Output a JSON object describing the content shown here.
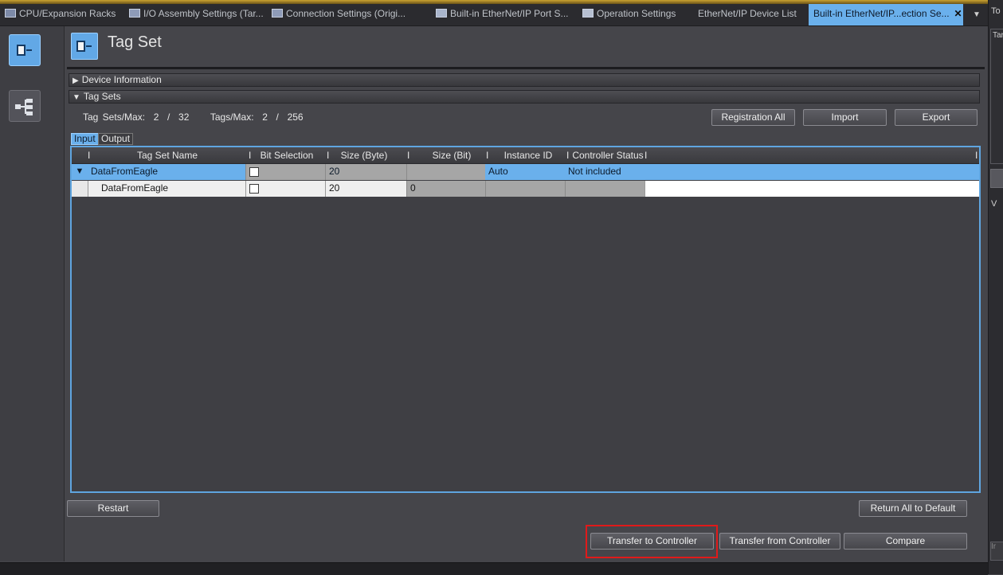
{
  "tabs": [
    {
      "label": "CPU/Expansion Racks",
      "icon": "rack-icon"
    },
    {
      "label": "I/O Assembly Settings (Tar...",
      "icon": "io-assembly-icon"
    },
    {
      "label": "Connection Settings (Origi...",
      "icon": "connection-icon"
    },
    {
      "label": "Built-in EtherNet/IP Port S...",
      "icon": "eip-port-icon"
    },
    {
      "label": "Operation Settings",
      "icon": "operation-icon"
    },
    {
      "label": "EtherNet/IP Device List",
      "icon": ""
    },
    {
      "label": "Built-in EtherNet/IP...ection Se...",
      "icon": "",
      "active": true,
      "close": "✕"
    }
  ],
  "right_panel": {
    "top_label": "To",
    "textarea_label": "Tar",
    "section_label": "V",
    "button_label": "Ir"
  },
  "title": "Tag Set",
  "sections": {
    "device_info": "Device Information",
    "tag_sets": "Tag Sets"
  },
  "stats": {
    "tag_sets_label": "Tag Sets/Max:",
    "tag_sets_value": "2  /  32",
    "tags_label": "Tags/Max:",
    "tags_value": "2  /  256"
  },
  "buttons": {
    "registration_all": "Registration All",
    "import": "Import",
    "export": "Export",
    "restart": "Restart",
    "return_all_default": "Return All to Default",
    "transfer_to_controller": "Transfer to Controller",
    "transfer_from_controller": "Transfer from Controller",
    "compare": "Compare"
  },
  "io_tabs": {
    "input": "Input",
    "output": "Output"
  },
  "table": {
    "columns": [
      "Tag Set Name",
      "Bit Selection",
      "Size (Byte)",
      "Size (Bit)",
      "Instance ID",
      "Controller Status"
    ],
    "rows": [
      {
        "expander": "▼",
        "name": "DataFromEagle",
        "bit_selection": false,
        "size_byte": "20",
        "size_bit": "",
        "instance_id": "Auto",
        "controller_status": "Not included"
      },
      {
        "expander": "",
        "name": "DataFromEagle",
        "bit_selection": false,
        "size_byte": "20",
        "size_bit": "0",
        "instance_id": "",
        "controller_status": ""
      }
    ]
  },
  "colors": {
    "accent": "#6ab0ec",
    "highlight_box": "#e01a1a",
    "background": "#45454a"
  }
}
